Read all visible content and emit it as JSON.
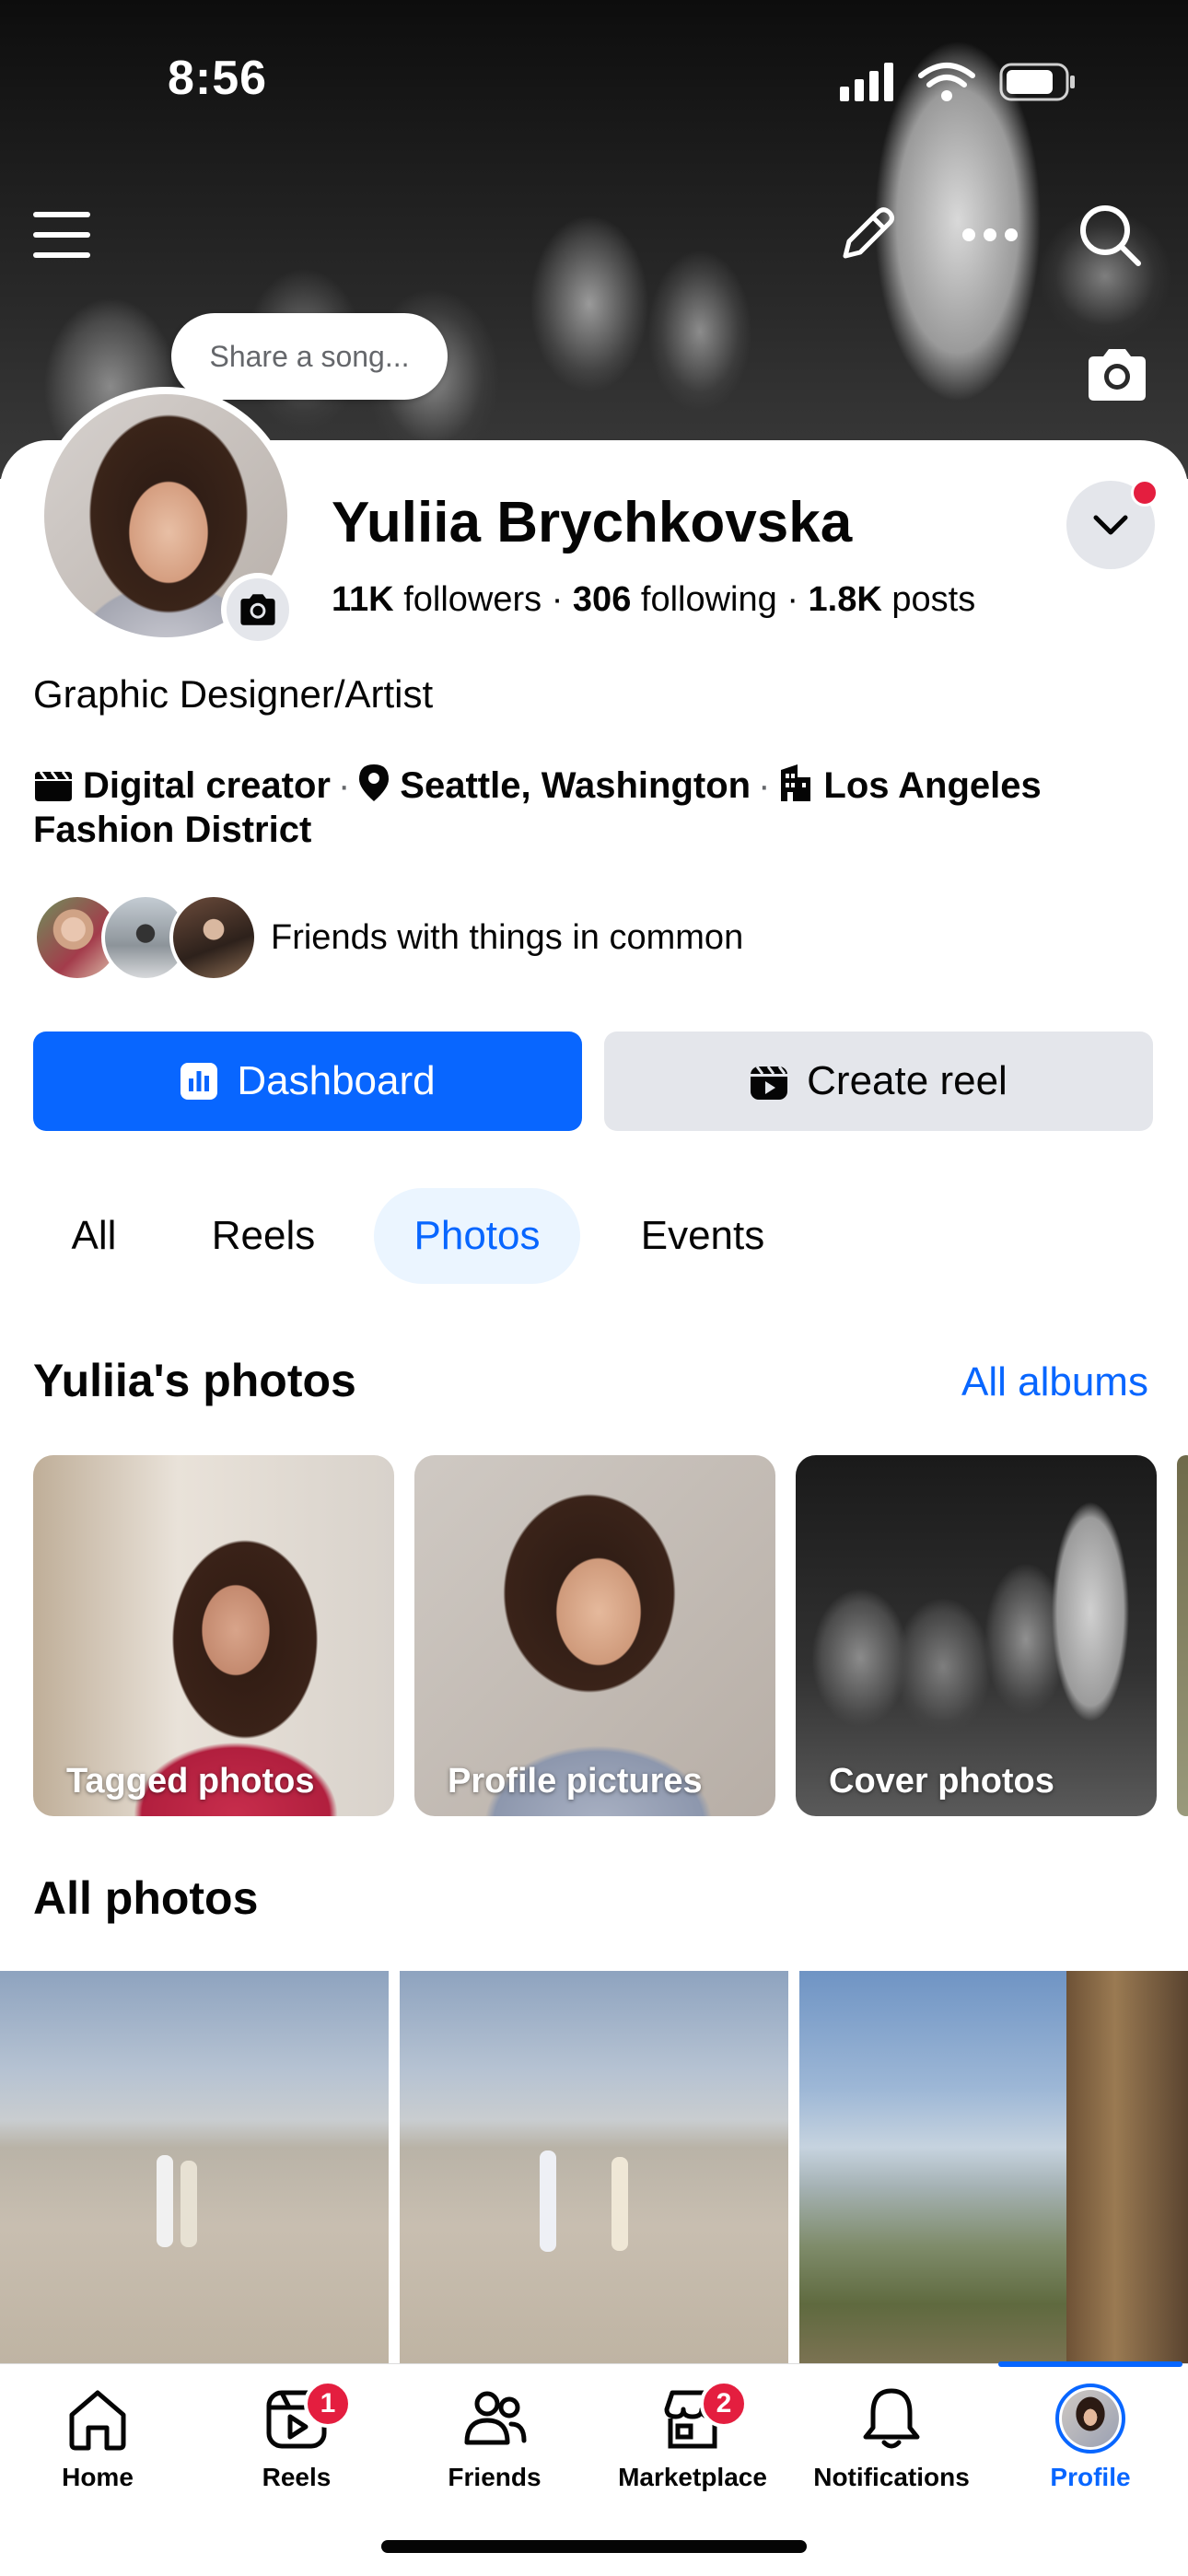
{
  "status_bar": {
    "time": "8:56"
  },
  "cover": {
    "song_prompt": "Share a song..."
  },
  "profile": {
    "name": "Yuliia Brychkovska",
    "followers_count": "11K",
    "followers_label": "followers",
    "following_count": "306",
    "following_label": "following",
    "posts_count": "1.8K",
    "posts_label": "posts",
    "bio": "Graphic Designer/Artist",
    "category": "Digital creator",
    "location": "Seattle, Washington",
    "workplace": "Los Angeles Fashion District",
    "friends_common": "Friends with things in common"
  },
  "actions": {
    "dashboard": "Dashboard",
    "create_reel": "Create reel"
  },
  "tabs": [
    {
      "label": "All"
    },
    {
      "label": "Reels"
    },
    {
      "label": "Photos",
      "active": true
    },
    {
      "label": "Events"
    }
  ],
  "photos_section": {
    "heading": "Yuliia's photos",
    "all_albums": "All albums",
    "albums": [
      {
        "label": "Tagged photos"
      },
      {
        "label": "Profile pictures"
      },
      {
        "label": "Cover photos"
      }
    ],
    "all_photos_heading": "All photos"
  },
  "bottom_nav": {
    "items": [
      {
        "label": "Home",
        "icon": "home-icon"
      },
      {
        "label": "Reels",
        "icon": "reels-icon",
        "badge": "1"
      },
      {
        "label": "Friends",
        "icon": "friends-icon"
      },
      {
        "label": "Marketplace",
        "icon": "marketplace-icon",
        "badge": "2"
      },
      {
        "label": "Notifications",
        "icon": "bell-icon"
      },
      {
        "label": "Profile",
        "icon": "profile-avatar",
        "active": true
      }
    ]
  },
  "colors": {
    "accent": "#0866ff",
    "badge": "#e41e3f",
    "secondary_button": "#e4e6eb",
    "active_tab_bg": "#ebf5ff"
  }
}
